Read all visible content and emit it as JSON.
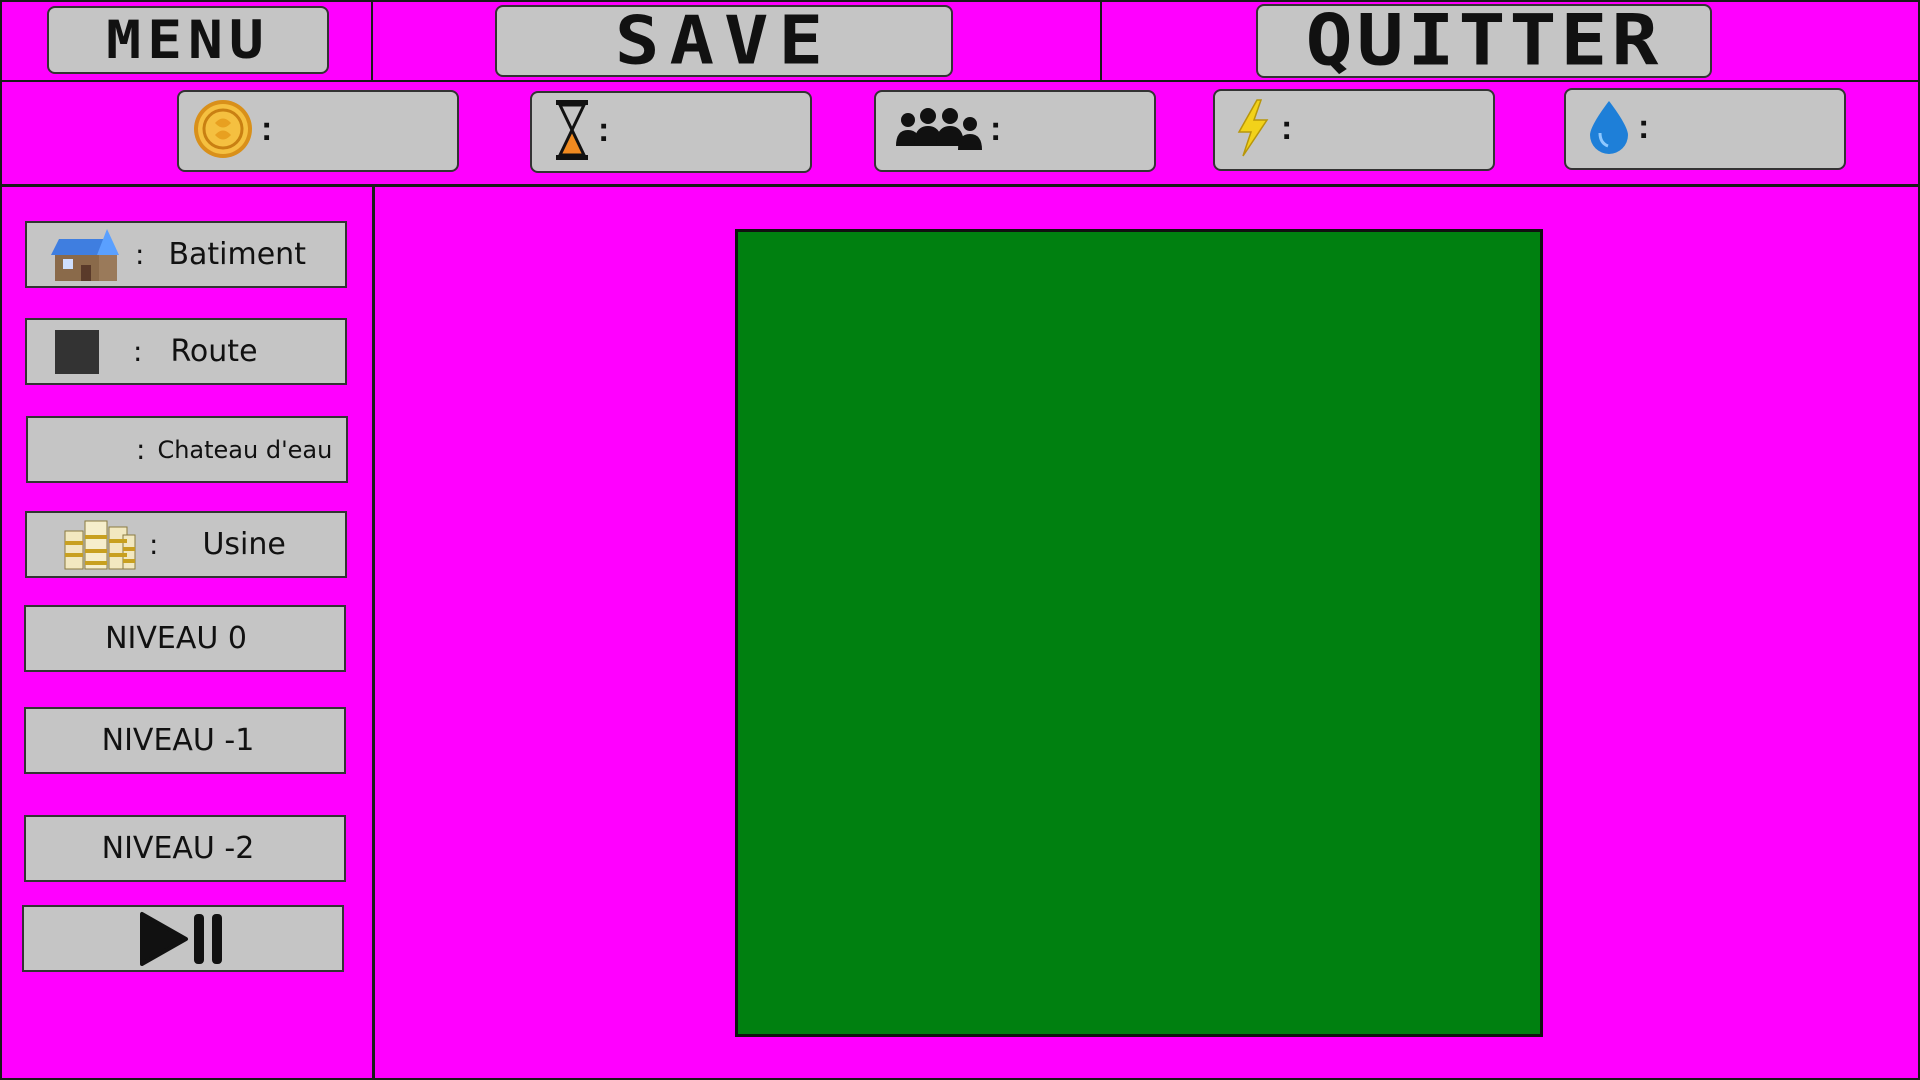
{
  "topbar": {
    "menu_label": "MENU",
    "save_label": "SAVE",
    "quit_label": "QUITTER"
  },
  "resources": [
    {
      "icon": "coin-icon",
      "separator": ":",
      "value": ""
    },
    {
      "icon": "hourglass-icon",
      "separator": ":",
      "value": ""
    },
    {
      "icon": "population-icon",
      "separator": ":",
      "value": ""
    },
    {
      "icon": "lightning-icon",
      "separator": ":",
      "value": ""
    },
    {
      "icon": "water-drop-icon",
      "separator": ":",
      "value": ""
    }
  ],
  "sidebar": {
    "items": [
      {
        "icon": "building-icon",
        "separator": ":",
        "label": "Batiment"
      },
      {
        "icon": "road-icon",
        "separator": ":",
        "label": "Route"
      },
      {
        "icon": "",
        "separator": ":",
        "label": "Chateau d'eau"
      },
      {
        "icon": "factory-icon",
        "separator": ":",
        "label": "Usine"
      }
    ],
    "levels": [
      "NIVEAU 0",
      "NIVEAU -1",
      "NIVEAU -2"
    ],
    "play_pause_icon": "play-pause-icon"
  },
  "colors": {
    "background": "#ff00ff",
    "map": "#008010",
    "button": "#c5c5c5"
  }
}
